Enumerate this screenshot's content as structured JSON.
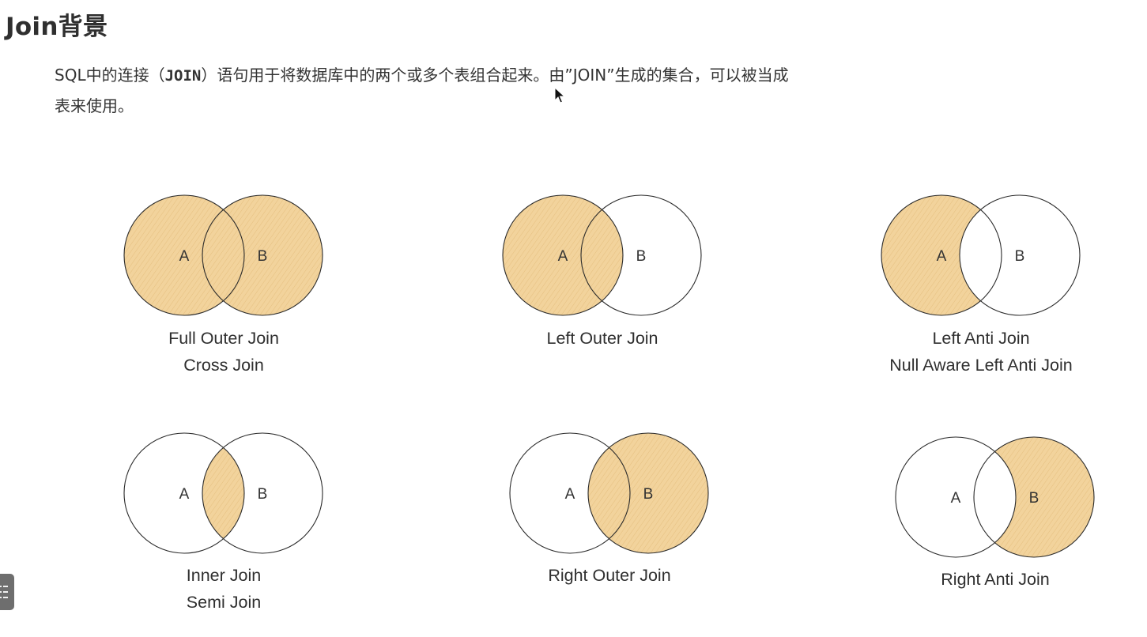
{
  "heading": "Join背景",
  "paragraph": {
    "before_code": "SQL中的连接（",
    "code": "JOIN",
    "after_code": "）语句用于将数据库中的两个或多个表组合起来。由”JOIN”生成的集合，可以被当成表来使用。"
  },
  "circle_labels": {
    "left": "A",
    "right": "B"
  },
  "colors": {
    "fill": "#f2d39c",
    "hatch": "#d8a960",
    "stroke": "#2a2a2a"
  },
  "diagrams": [
    {
      "id": "full-outer",
      "shade": "full",
      "captions": [
        "Full Outer Join",
        "Cross Join"
      ]
    },
    {
      "id": "left-outer",
      "shade": "left",
      "captions": [
        "Left Outer Join"
      ]
    },
    {
      "id": "left-anti",
      "shade": "left-only",
      "captions": [
        "Left Anti Join",
        "Null Aware Left Anti Join"
      ]
    },
    {
      "id": "inner",
      "shade": "intersection",
      "captions": [
        "Inner Join",
        "Semi Join"
      ]
    },
    {
      "id": "right-outer",
      "shade": "right",
      "captions": [
        "Right Outer Join"
      ]
    },
    {
      "id": "right-anti",
      "shade": "right-only",
      "captions": [
        "Right Anti Join"
      ]
    }
  ]
}
